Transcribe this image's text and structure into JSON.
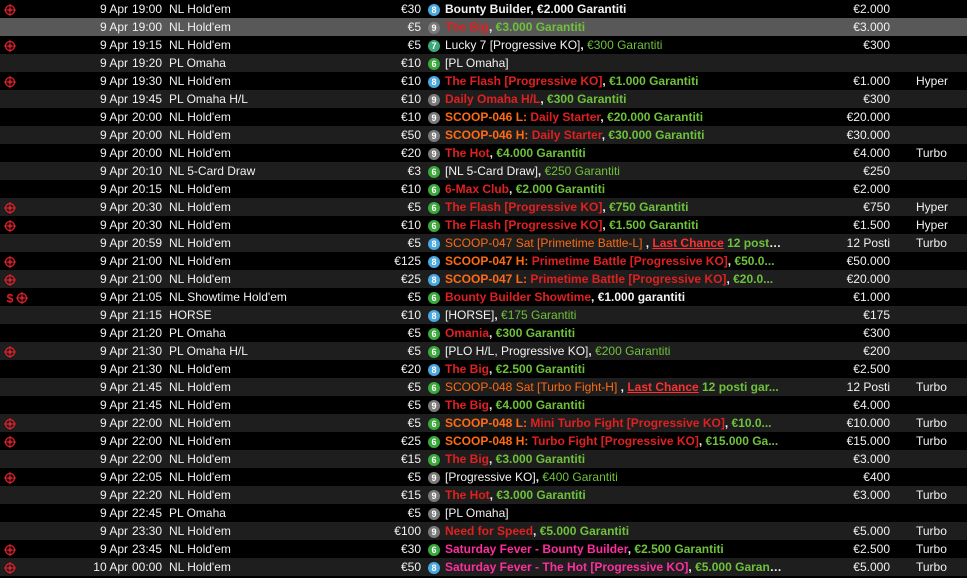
{
  "colors": {
    "background": "#000000",
    "row_alt": "#1e1e1e",
    "row_selected": "#585858",
    "guaranteed_green": "#6ec23a",
    "featured_red": "#e02020",
    "scoop_orange": "#ff6a12",
    "saturday_pink": "#ff2e9e",
    "badge_blue": "#4aa8e0",
    "badge_green": "#3aa83a",
    "badge_gray": "#7a7a7a"
  },
  "rows": [
    {
      "icons": [
        "bounty-icon"
      ],
      "date": "9 Apr",
      "time": "19:00",
      "game": "NL Hold'em",
      "buyin": "€30",
      "badge": "8",
      "badge_color": "#4aa8e0",
      "name_parts": [
        {
          "t": "Bounty Builder",
          "c": "white"
        },
        {
          "t": ", ",
          "c": "white"
        },
        {
          "t": "€2.000 Garantiti",
          "c": "white"
        }
      ],
      "prize": "€2.000",
      "speed": ""
    },
    {
      "icons": [],
      "date": "9 Apr",
      "time": "19:00",
      "game": "NL Hold'em",
      "buyin": "€5",
      "badge": "9",
      "badge_color": "#7a7a7a",
      "name_parts": [
        {
          "t": "The Big",
          "c": "red"
        },
        {
          "t": ", ",
          "c": "white"
        },
        {
          "t": "€3.000 Garantiti",
          "c": "gtee"
        }
      ],
      "prize": "€3.000",
      "speed": ""
    },
    {
      "icons": [
        "bounty-icon"
      ],
      "date": "9 Apr",
      "time": "19:15",
      "game": "NL Hold'em",
      "buyin": "€5",
      "badge": "7",
      "badge_color": "#3aa87a",
      "name_parts": [
        {
          "t": "Lucky 7 [Progressive KO]",
          "c": "white",
          "plain": true
        },
        {
          "t": ", ",
          "c": "white"
        },
        {
          "t": "€300 Garantiti",
          "c": "gtee",
          "plain": true
        }
      ],
      "prize": "€300",
      "speed": ""
    },
    {
      "icons": [],
      "date": "9 Apr",
      "time": "19:20",
      "game": "PL Omaha",
      "buyin": "€10",
      "badge": "6",
      "badge_color": "#3aa83a",
      "name_parts": [
        {
          "t": "[PL Omaha]",
          "c": "white",
          "plain": true
        }
      ],
      "prize": "",
      "speed": ""
    },
    {
      "icons": [
        "bounty-icon"
      ],
      "date": "9 Apr",
      "time": "19:30",
      "game": "NL Hold'em",
      "buyin": "€10",
      "badge": "8",
      "badge_color": "#4aa8e0",
      "name_parts": [
        {
          "t": "The Flash [Progressive KO]",
          "c": "red"
        },
        {
          "t": ", ",
          "c": "white"
        },
        {
          "t": "€1.000 Garantiti",
          "c": "gtee"
        }
      ],
      "prize": "€1.000",
      "speed": "Hyper"
    },
    {
      "icons": [],
      "date": "9 Apr",
      "time": "19:45",
      "game": "PL Omaha H/L",
      "buyin": "€10",
      "badge": "9",
      "badge_color": "#7a7a7a",
      "name_parts": [
        {
          "t": "Daily Omaha H/L",
          "c": "red"
        },
        {
          "t": ", ",
          "c": "white"
        },
        {
          "t": "€300 Garantiti",
          "c": "gtee"
        }
      ],
      "prize": "€300",
      "speed": ""
    },
    {
      "icons": [],
      "date": "9 Apr",
      "time": "20:00",
      "game": "NL Hold'em",
      "buyin": "€10",
      "badge": "9",
      "badge_color": "#7a7a7a",
      "name_parts": [
        {
          "t": "SCOOP-046 L:  ",
          "c": "orange"
        },
        {
          "t": "Daily Starter",
          "c": "red"
        },
        {
          "t": ", ",
          "c": "white"
        },
        {
          "t": "€20.000 Garantiti",
          "c": "gtee"
        }
      ],
      "prize": "€20.000",
      "speed": ""
    },
    {
      "icons": [],
      "date": "9 Apr",
      "time": "20:00",
      "game": "NL Hold'em",
      "buyin": "€50",
      "badge": "9",
      "badge_color": "#7a7a7a",
      "name_parts": [
        {
          "t": "SCOOP-046 H:  ",
          "c": "orange"
        },
        {
          "t": "Daily Starter",
          "c": "red"
        },
        {
          "t": ", ",
          "c": "white"
        },
        {
          "t": "€30.000 Garantiti",
          "c": "gtee"
        }
      ],
      "prize": "€30.000",
      "speed": ""
    },
    {
      "icons": [],
      "date": "9 Apr",
      "time": "20:00",
      "game": "NL Hold'em",
      "buyin": "€20",
      "badge": "9",
      "badge_color": "#7a7a7a",
      "name_parts": [
        {
          "t": "The Hot",
          "c": "red"
        },
        {
          "t": ", ",
          "c": "white"
        },
        {
          "t": "€4.000 Garantiti",
          "c": "gtee"
        }
      ],
      "prize": "€4.000",
      "speed": "Turbo"
    },
    {
      "icons": [],
      "date": "9 Apr",
      "time": "20:10",
      "game": "NL 5-Card Draw",
      "buyin": "€3",
      "badge": "6",
      "badge_color": "#3aa83a",
      "name_parts": [
        {
          "t": "[NL 5-Card Draw]",
          "c": "white",
          "plain": true
        },
        {
          "t": ", ",
          "c": "white"
        },
        {
          "t": "€250 Garantiti",
          "c": "gtee",
          "plain": true
        }
      ],
      "prize": "€250",
      "speed": ""
    },
    {
      "icons": [],
      "date": "9 Apr",
      "time": "20:15",
      "game": "NL Hold'em",
      "buyin": "€10",
      "badge": "6",
      "badge_color": "#3aa83a",
      "name_parts": [
        {
          "t": "6-Max Club",
          "c": "red"
        },
        {
          "t": ", ",
          "c": "white"
        },
        {
          "t": "€2.000 Garantiti",
          "c": "gtee"
        }
      ],
      "prize": "€2.000",
      "speed": ""
    },
    {
      "icons": [
        "bounty-icon"
      ],
      "date": "9 Apr",
      "time": "20:30",
      "game": "NL Hold'em",
      "buyin": "€5",
      "badge": "6",
      "badge_color": "#3aa83a",
      "name_parts": [
        {
          "t": "The Flash [Progressive KO]",
          "c": "red"
        },
        {
          "t": ", ",
          "c": "white"
        },
        {
          "t": "€750 Garantiti",
          "c": "gtee"
        }
      ],
      "prize": "€750",
      "speed": "Hyper"
    },
    {
      "icons": [
        "bounty-icon"
      ],
      "date": "9 Apr",
      "time": "20:30",
      "game": "NL Hold'em",
      "buyin": "€10",
      "badge": "6",
      "badge_color": "#3aa83a",
      "name_parts": [
        {
          "t": "The Flash [Progressive KO]",
          "c": "red"
        },
        {
          "t": ", ",
          "c": "white"
        },
        {
          "t": "€1.500 Garantiti",
          "c": "gtee"
        }
      ],
      "prize": "€1.500",
      "speed": "Hyper"
    },
    {
      "icons": [],
      "date": "9 Apr",
      "time": "20:59",
      "game": "NL Hold'em",
      "buyin": "€5",
      "badge": "8",
      "badge_color": "#4aa8e0",
      "name_parts": [
        {
          "t": "SCOOP-047 Sat [Primetime Battle-L]",
          "c": "orange",
          "plain": true
        },
        {
          "t": " , ",
          "c": "white"
        },
        {
          "t": "Last Chance",
          "c": "lc"
        },
        {
          "t": " 12 posti...",
          "c": "gtee"
        }
      ],
      "prize": "12 Posti",
      "speed": "Turbo"
    },
    {
      "icons": [
        "bounty-icon"
      ],
      "date": "9 Apr",
      "time": "21:00",
      "game": "NL Hold'em",
      "buyin": "€125",
      "badge": "8",
      "badge_color": "#4aa8e0",
      "name_parts": [
        {
          "t": "SCOOP-047 H:  ",
          "c": "orange"
        },
        {
          "t": "Primetime Battle [Progressive KO]",
          "c": "red"
        },
        {
          "t": ", ",
          "c": "white"
        },
        {
          "t": "€50.0...",
          "c": "gtee"
        }
      ],
      "prize": "€50.000",
      "speed": ""
    },
    {
      "icons": [
        "bounty-icon"
      ],
      "date": "9 Apr",
      "time": "21:00",
      "game": "NL Hold'em",
      "buyin": "€25",
      "badge": "8",
      "badge_color": "#4aa8e0",
      "name_parts": [
        {
          "t": "SCOOP-047 L:  ",
          "c": "orange"
        },
        {
          "t": "Primetime Battle [Progressive KO]",
          "c": "red"
        },
        {
          "t": ", ",
          "c": "white"
        },
        {
          "t": "€20.0...",
          "c": "gtee"
        }
      ],
      "prize": "€20.000",
      "speed": ""
    },
    {
      "icons": [
        "dollar-icon",
        "bounty-icon"
      ],
      "date": "9 Apr",
      "time": "21:05",
      "game": "NL Showtime Hold'em",
      "buyin": "€5",
      "badge": "6",
      "badge_color": "#3aa83a",
      "name_parts": [
        {
          "t": "Bounty Builder Showtime",
          "c": "red"
        },
        {
          "t": ", ",
          "c": "white"
        },
        {
          "t": "€1.000 garantiti",
          "c": "white"
        }
      ],
      "prize": "€1.000",
      "speed": ""
    },
    {
      "icons": [],
      "date": "9 Apr",
      "time": "21:15",
      "game": "HORSE",
      "buyin": "€10",
      "badge": "8",
      "badge_color": "#4aa8e0",
      "name_parts": [
        {
          "t": "[HORSE]",
          "c": "white",
          "plain": true
        },
        {
          "t": ", ",
          "c": "white"
        },
        {
          "t": "€175 Garantiti",
          "c": "gtee",
          "plain": true
        }
      ],
      "prize": "€175",
      "speed": ""
    },
    {
      "icons": [],
      "date": "9 Apr",
      "time": "21:20",
      "game": "PL Omaha",
      "buyin": "€5",
      "badge": "6",
      "badge_color": "#3aa83a",
      "name_parts": [
        {
          "t": "Omania",
          "c": "red"
        },
        {
          "t": ", ",
          "c": "white"
        },
        {
          "t": "€300 Garantiti",
          "c": "gtee"
        }
      ],
      "prize": "€300",
      "speed": ""
    },
    {
      "icons": [
        "bounty-icon"
      ],
      "date": "9 Apr",
      "time": "21:30",
      "game": "PL Omaha H/L",
      "buyin": "€5",
      "badge": "6",
      "badge_color": "#3aa83a",
      "name_parts": [
        {
          "t": "[PLO H/L, Progressive KO]",
          "c": "white",
          "plain": true
        },
        {
          "t": ", ",
          "c": "white"
        },
        {
          "t": "€200 Garantiti",
          "c": "gtee",
          "plain": true
        }
      ],
      "prize": "€200",
      "speed": ""
    },
    {
      "icons": [],
      "date": "9 Apr",
      "time": "21:30",
      "game": "NL Hold'em",
      "buyin": "€20",
      "badge": "8",
      "badge_color": "#4aa8e0",
      "name_parts": [
        {
          "t": "The Big",
          "c": "red"
        },
        {
          "t": ", ",
          "c": "white"
        },
        {
          "t": "€2.500 Garantiti",
          "c": "gtee"
        }
      ],
      "prize": "€2.500",
      "speed": ""
    },
    {
      "icons": [],
      "date": "9 Apr",
      "time": "21:45",
      "game": "NL Hold'em",
      "buyin": "€5",
      "badge": "6",
      "badge_color": "#3aa83a",
      "name_parts": [
        {
          "t": "SCOOP-048 Sat [Turbo Fight-H]",
          "c": "orange",
          "plain": true
        },
        {
          "t": " , ",
          "c": "white"
        },
        {
          "t": "Last Chance",
          "c": "lc"
        },
        {
          "t": " 12 posti gar...",
          "c": "gtee"
        }
      ],
      "prize": "12 Posti",
      "speed": "Turbo"
    },
    {
      "icons": [],
      "date": "9 Apr",
      "time": "21:45",
      "game": "NL Hold'em",
      "buyin": "€5",
      "badge": "9",
      "badge_color": "#7a7a7a",
      "name_parts": [
        {
          "t": "The Big",
          "c": "red"
        },
        {
          "t": ", ",
          "c": "white"
        },
        {
          "t": "€4.000 Garantiti",
          "c": "gtee"
        }
      ],
      "prize": "€4.000",
      "speed": ""
    },
    {
      "icons": [
        "bounty-icon"
      ],
      "date": "9 Apr",
      "time": "22:00",
      "game": "NL Hold'em",
      "buyin": "€5",
      "badge": "6",
      "badge_color": "#3aa83a",
      "name_parts": [
        {
          "t": "SCOOP-048 L:  ",
          "c": "orange"
        },
        {
          "t": "Mini Turbo Fight [Progressive KO]",
          "c": "red"
        },
        {
          "t": ", ",
          "c": "white"
        },
        {
          "t": "€10.0...",
          "c": "gtee"
        }
      ],
      "prize": "€10.000",
      "speed": "Turbo"
    },
    {
      "icons": [
        "bounty-icon"
      ],
      "date": "9 Apr",
      "time": "22:00",
      "game": "NL Hold'em",
      "buyin": "€25",
      "badge": "6",
      "badge_color": "#3aa83a",
      "name_parts": [
        {
          "t": "SCOOP-048 H:  ",
          "c": "orange"
        },
        {
          "t": "Turbo Fight [Progressive KO]",
          "c": "red"
        },
        {
          "t": ", ",
          "c": "white"
        },
        {
          "t": "€15.000 Ga...",
          "c": "gtee"
        }
      ],
      "prize": "€15.000",
      "speed": "Turbo"
    },
    {
      "icons": [],
      "date": "9 Apr",
      "time": "22:00",
      "game": "NL Hold'em",
      "buyin": "€15",
      "badge": "6",
      "badge_color": "#3aa83a",
      "name_parts": [
        {
          "t": "The Big",
          "c": "red"
        },
        {
          "t": ", ",
          "c": "white"
        },
        {
          "t": "€3.000 Garantiti",
          "c": "gtee"
        }
      ],
      "prize": "€3.000",
      "speed": ""
    },
    {
      "icons": [
        "bounty-icon"
      ],
      "date": "9 Apr",
      "time": "22:05",
      "game": "NL Hold'em",
      "buyin": "€5",
      "badge": "9",
      "badge_color": "#7a7a7a",
      "name_parts": [
        {
          "t": "[Progressive KO]",
          "c": "white",
          "plain": true
        },
        {
          "t": ", ",
          "c": "white"
        },
        {
          "t": "€400 Garantiti",
          "c": "gtee",
          "plain": true
        }
      ],
      "prize": "€400",
      "speed": ""
    },
    {
      "icons": [],
      "date": "9 Apr",
      "time": "22:20",
      "game": "NL Hold'em",
      "buyin": "€15",
      "badge": "9",
      "badge_color": "#7a7a7a",
      "name_parts": [
        {
          "t": "The Hot",
          "c": "red"
        },
        {
          "t": ", ",
          "c": "white"
        },
        {
          "t": "€3.000 Garantiti",
          "c": "gtee"
        }
      ],
      "prize": "€3.000",
      "speed": "Turbo"
    },
    {
      "icons": [],
      "date": "9 Apr",
      "time": "22:45",
      "game": "PL Omaha",
      "buyin": "€5",
      "badge": "9",
      "badge_color": "#7a7a7a",
      "name_parts": [
        {
          "t": "[PL Omaha]",
          "c": "white",
          "plain": true
        }
      ],
      "prize": "",
      "speed": ""
    },
    {
      "icons": [],
      "date": "9 Apr",
      "time": "23:30",
      "game": "NL Hold'em",
      "buyin": "€100",
      "badge": "9",
      "badge_color": "#7a7a7a",
      "name_parts": [
        {
          "t": "Need for Speed",
          "c": "red"
        },
        {
          "t": ", ",
          "c": "white"
        },
        {
          "t": "€5.000 Garantiti",
          "c": "gtee"
        }
      ],
      "prize": "€5.000",
      "speed": "Turbo"
    },
    {
      "icons": [
        "bounty-icon"
      ],
      "date": "9 Apr",
      "time": "23:45",
      "game": "NL Hold'em",
      "buyin": "€30",
      "badge": "6",
      "badge_color": "#3aa83a",
      "name_parts": [
        {
          "t": "Saturday Fever - Bounty Builder",
          "c": "pink"
        },
        {
          "t": ", ",
          "c": "white"
        },
        {
          "t": "€2.500 Garantiti",
          "c": "gtee"
        }
      ],
      "prize": "€2.500",
      "speed": "Turbo"
    },
    {
      "icons": [
        "bounty-icon"
      ],
      "date": "10 Apr",
      "time": "00:00",
      "game": "NL Hold'em",
      "buyin": "€50",
      "badge": "8",
      "badge_color": "#4aa8e0",
      "name_parts": [
        {
          "t": "Saturday Fever - The Hot [Progressive KO]",
          "c": "pink"
        },
        {
          "t": ", ",
          "c": "white"
        },
        {
          "t": "€5.000 Garantiti",
          "c": "gtee"
        }
      ],
      "prize": "€5.000",
      "speed": "Turbo"
    }
  ]
}
